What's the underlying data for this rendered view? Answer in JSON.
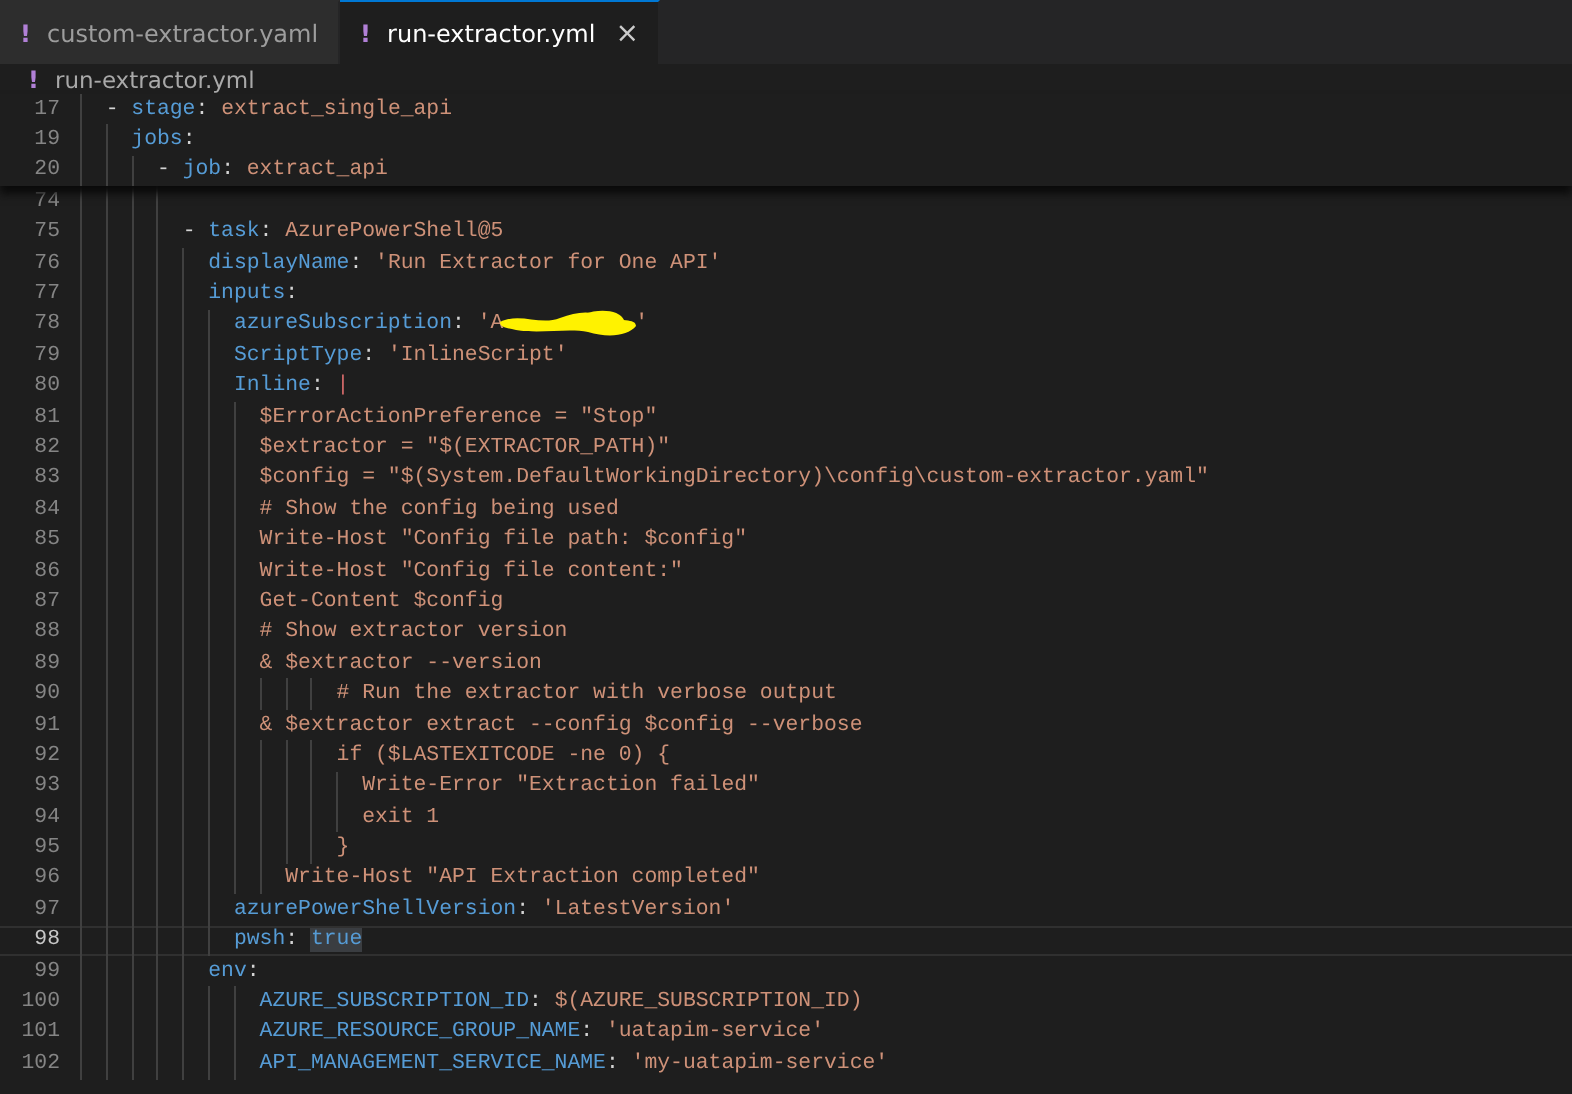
{
  "tabs": [
    {
      "icon": "!",
      "label": "custom-extractor.yaml",
      "selected": false
    },
    {
      "icon": "!",
      "label": "run-extractor.yml",
      "selected": true,
      "close": "×"
    }
  ],
  "breadcrumb": {
    "icon": "!",
    "label": "run-extractor.yml"
  },
  "sticky_lines": [
    {
      "number": "17",
      "current": false,
      "segments": [
        {
          "kind": "punct",
          "text": "- "
        },
        {
          "kind": "key",
          "text": "stage"
        },
        {
          "kind": "punct",
          "text": ": "
        },
        {
          "kind": "string",
          "text": "extract_single_api"
        }
      ],
      "children": [
        {
          "number": "19",
          "current": false,
          "segments": [
            {
              "kind": "key",
              "text": "jobs"
            },
            {
              "kind": "punct",
              "text": ":"
            }
          ],
          "children": [
            {
              "number": "20",
              "current": false,
              "segments": [
                {
                  "kind": "punct",
                  "text": "- "
                },
                {
                  "kind": "key",
                  "text": "job"
                },
                {
                  "kind": "punct",
                  "text": ": "
                },
                {
                  "kind": "string",
                  "text": "extract_api"
                }
              ]
            }
          ]
        }
      ]
    }
  ],
  "lines": [
    {
      "children": [
        {
          "children": [
            {
              "children": [
                {
                  "number": "74",
                  "current": false
                },
                {
                  "number": "75",
                  "current": false,
                  "segments": [
                    {
                      "kind": "punct",
                      "text": "- "
                    },
                    {
                      "kind": "key",
                      "text": "task"
                    },
                    {
                      "kind": "punct",
                      "text": ": "
                    },
                    {
                      "kind": "string",
                      "text": "AzurePowerShell@5"
                    }
                  ],
                  "children": [
                    {
                      "number": "76",
                      "current": false,
                      "segments": [
                        {
                          "kind": "key",
                          "text": "displayName"
                        },
                        {
                          "kind": "punct",
                          "text": ": "
                        },
                        {
                          "kind": "string",
                          "text": "'Run Extractor for One API'"
                        }
                      ]
                    },
                    {
                      "number": "77",
                      "current": false,
                      "segments": [
                        {
                          "kind": "key",
                          "text": "inputs"
                        },
                        {
                          "kind": "punct",
                          "text": ":"
                        }
                      ],
                      "children": [
                        {
                          "number": "78",
                          "current": false,
                          "segments": [
                            {
                              "kind": "key",
                              "text": "azureSubscription"
                            },
                            {
                              "kind": "punct",
                              "text": ": "
                            },
                            {
                              "kind": "string",
                              "text": "'A"
                            },
                            {
                              "kind": "redacted"
                            },
                            {
                              "kind": "string",
                              "text": "'"
                            }
                          ]
                        },
                        {
                          "number": "79",
                          "current": false,
                          "segments": [
                            {
                              "kind": "key",
                              "text": "ScriptType"
                            },
                            {
                              "kind": "punct",
                              "text": ": "
                            },
                            {
                              "kind": "string",
                              "text": "'InlineScript'"
                            }
                          ]
                        },
                        {
                          "number": "80",
                          "current": false,
                          "segments": [
                            {
                              "kind": "key",
                              "text": "Inline"
                            },
                            {
                              "kind": "punct",
                              "text": ": "
                            },
                            {
                              "kind": "pipe",
                              "text": "|"
                            }
                          ],
                          "children": [
                            {
                              "number": "81",
                              "current": false,
                              "segments": [
                                {
                                  "kind": "string",
                                  "text": "$ErrorActionPreference = \"Stop\""
                                }
                              ]
                            },
                            {
                              "number": "82",
                              "current": false,
                              "segments": [
                                {
                                  "kind": "string",
                                  "text": "$extractor = \"$(EXTRACTOR_PATH)\""
                                }
                              ]
                            },
                            {
                              "number": "83",
                              "current": false,
                              "segments": [
                                {
                                  "kind": "string",
                                  "text": "$config = \"$(System.DefaultWorkingDirectory)\\config\\custom-extractor.yaml\""
                                }
                              ]
                            },
                            {
                              "number": "84",
                              "current": false,
                              "segments": [
                                {
                                  "kind": "string",
                                  "text": "# Show the config being used"
                                }
                              ]
                            },
                            {
                              "number": "85",
                              "current": false,
                              "segments": [
                                {
                                  "kind": "string",
                                  "text": "Write-Host \"Config file path: $config\""
                                }
                              ]
                            },
                            {
                              "number": "86",
                              "current": false,
                              "segments": [
                                {
                                  "kind": "string",
                                  "text": "Write-Host \"Config file content:\""
                                }
                              ]
                            },
                            {
                              "number": "87",
                              "current": false,
                              "segments": [
                                {
                                  "kind": "string",
                                  "text": "Get-Content $config"
                                }
                              ]
                            },
                            {
                              "number": "88",
                              "current": false,
                              "segments": [
                                {
                                  "kind": "string",
                                  "text": "# Show extractor version"
                                }
                              ]
                            },
                            {
                              "number": "89",
                              "current": false,
                              "segments": [
                                {
                                  "kind": "string",
                                  "text": "& $extractor --version"
                                }
                              ]
                            },
                            {
                              "children": [
                                {
                                  "children": [
                                    {
                                      "children": [
                                        {
                                          "number": "90",
                                          "current": false,
                                          "segments": [
                                            {
                                              "kind": "string",
                                              "text": "# Run the extractor with verbose output"
                                            }
                                          ]
                                        }
                                      ]
                                    }
                                  ]
                                }
                              ]
                            },
                            {
                              "number": "91",
                              "current": false,
                              "segments": [
                                {
                                  "kind": "string",
                                  "text": "& $extractor extract --config $config --verbose"
                                }
                              ]
                            },
                            {
                              "children": [
                                {
                                  "children": [
                                    {
                                      "children": [
                                        {
                                          "number": "92",
                                          "current": false,
                                          "segments": [
                                            {
                                              "kind": "string",
                                              "text": "if ($LASTEXITCODE -ne 0) {"
                                            }
                                          ],
                                          "children": [
                                            {
                                              "number": "93",
                                              "current": false,
                                              "segments": [
                                                {
                                                  "kind": "string",
                                                  "text": "Write-Error \"Extraction failed\""
                                                }
                                              ]
                                            },
                                            {
                                              "number": "94",
                                              "current": false,
                                              "segments": [
                                                {
                                                  "kind": "string",
                                                  "text": "exit 1"
                                                }
                                              ]
                                            }
                                          ]
                                        },
                                        {
                                          "number": "95",
                                          "current": false,
                                          "segments": [
                                            {
                                              "kind": "string",
                                              "text": "}"
                                            }
                                          ]
                                        }
                                      ]
                                    }
                                  ]
                                }
                              ]
                            },
                            {
                              "children": [
                                {
                                  "number": "96",
                                  "current": false,
                                  "segments": [
                                    {
                                      "kind": "string",
                                      "text": "Write-Host \"API Extraction completed\""
                                    }
                                  ]
                                }
                              ]
                            }
                          ]
                        },
                        {
                          "number": "97",
                          "current": false,
                          "segments": [
                            {
                              "kind": "key",
                              "text": "azurePowerShellVersion"
                            },
                            {
                              "kind": "punct",
                              "text": ": "
                            },
                            {
                              "kind": "string",
                              "text": "'LatestVersion'"
                            }
                          ]
                        },
                        {
                          "number": "98",
                          "current": true,
                          "segments": [
                            {
                              "kind": "key",
                              "text": "pwsh"
                            },
                            {
                              "kind": "punct",
                              "text": ": "
                            },
                            {
                              "kind": "highlighted",
                              "text": "true"
                            }
                          ]
                        }
                      ]
                    },
                    {
                      "number": "99",
                      "current": false,
                      "segments": [
                        {
                          "kind": "key",
                          "text": "env"
                        },
                        {
                          "kind": "punct",
                          "text": ":"
                        }
                      ],
                      "children": [
                        {
                          "children": [
                            {
                              "number": "100",
                              "current": false,
                              "segments": [
                                {
                                  "kind": "key",
                                  "text": "AZURE_SUBSCRIPTION_ID"
                                },
                                {
                                  "kind": "punct",
                                  "text": ": "
                                },
                                {
                                  "kind": "string",
                                  "text": "$(AZURE_SUBSCRIPTION_ID)"
                                }
                              ]
                            },
                            {
                              "number": "101",
                              "current": false,
                              "segments": [
                                {
                                  "kind": "key",
                                  "text": "AZURE_RESOURCE_GROUP_NAME"
                                },
                                {
                                  "kind": "punct",
                                  "text": ": "
                                },
                                {
                                  "kind": "string",
                                  "text": "'uatapim-service'"
                                }
                              ]
                            },
                            {
                              "number": "102",
                              "current": false,
                              "segments": [
                                {
                                  "kind": "key",
                                  "text": "API_MANAGEMENT_SERVICE_NAME"
                                },
                                {
                                  "kind": "punct",
                                  "text": ": "
                                },
                                {
                                  "kind": "string",
                                  "text": "'my-uatapim-service'"
                                }
                              ]
                            }
                          ]
                        }
                      ]
                    }
                  ]
                }
              ]
            }
          ]
        }
      ]
    }
  ]
}
